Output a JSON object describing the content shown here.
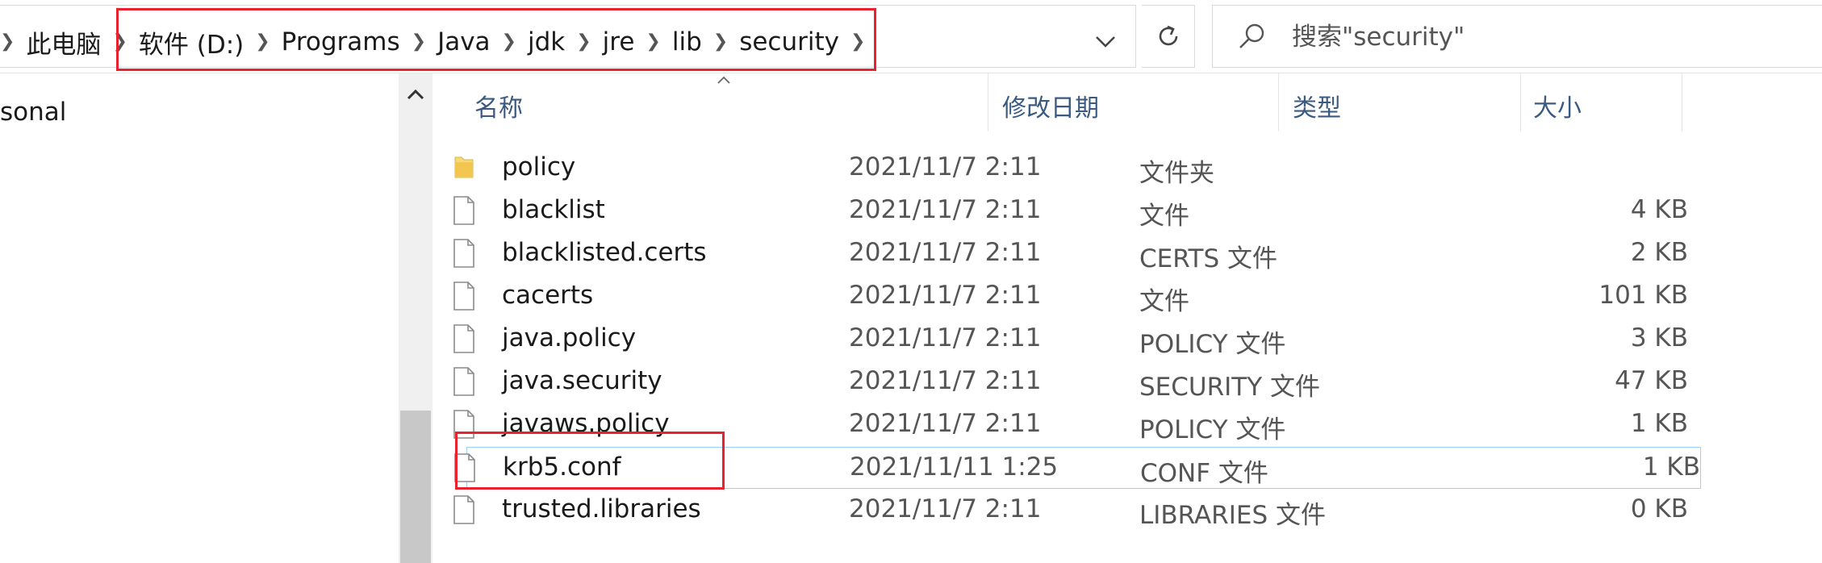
{
  "breadcrumb": {
    "items": [
      "此电脑",
      "软件 (D:)",
      "Programs",
      "Java",
      "jdk",
      "jre",
      "lib",
      "security"
    ]
  },
  "search": {
    "placeholder": "搜索\"security\""
  },
  "nav": {
    "partial_item": "sonal"
  },
  "columns": {
    "name": "名称",
    "modified": "修改日期",
    "type": "类型",
    "size": "大小"
  },
  "files": [
    {
      "name": "policy",
      "modified": "2021/11/7 2:11",
      "type": "文件夹",
      "size": "",
      "icon": "folder-icon"
    },
    {
      "name": "blacklist",
      "modified": "2021/11/7 2:11",
      "type": "文件",
      "size": "4 KB",
      "icon": "file-icon"
    },
    {
      "name": "blacklisted.certs",
      "modified": "2021/11/7 2:11",
      "type": "CERTS 文件",
      "size": "2 KB",
      "icon": "file-icon"
    },
    {
      "name": "cacerts",
      "modified": "2021/11/7 2:11",
      "type": "文件",
      "size": "101 KB",
      "icon": "file-icon"
    },
    {
      "name": "java.policy",
      "modified": "2021/11/7 2:11",
      "type": "POLICY 文件",
      "size": "3 KB",
      "icon": "file-icon"
    },
    {
      "name": "java.security",
      "modified": "2021/11/7 2:11",
      "type": "SECURITY 文件",
      "size": "47 KB",
      "icon": "file-icon"
    },
    {
      "name": "javaws.policy",
      "modified": "2021/11/7 2:11",
      "type": "POLICY 文件",
      "size": "1 KB",
      "icon": "file-icon"
    },
    {
      "name": "krb5.conf",
      "modified": "2021/11/11 1:25",
      "type": "CONF 文件",
      "size": "1 KB",
      "icon": "file-icon"
    },
    {
      "name": "trusted.libraries",
      "modified": "2021/11/7 2:11",
      "type": "LIBRARIES 文件",
      "size": "0 KB",
      "icon": "file-icon"
    }
  ],
  "colors": {
    "accent": "#3b5a82",
    "annotation": "#e8232d",
    "selection_border": "#99d1ff",
    "folder": "#f8d775"
  }
}
